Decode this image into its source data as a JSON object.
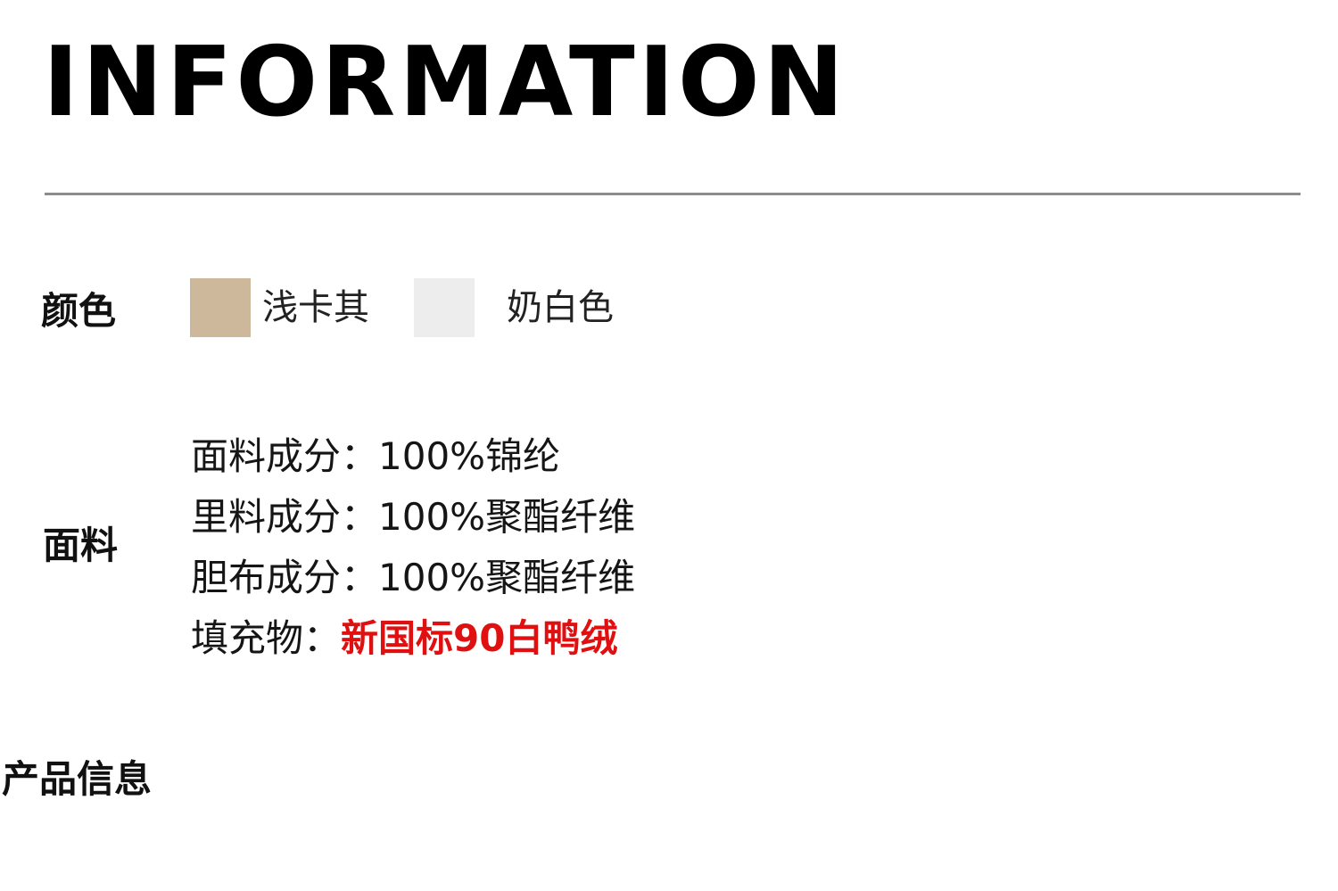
{
  "heading": "INFORMATION",
  "color_section": {
    "label": "颜色",
    "swatches": [
      {
        "name": "浅卡其",
        "hex": "#cdb89c"
      },
      {
        "name": "奶白色",
        "hex": "#ededed"
      }
    ]
  },
  "fabric_section": {
    "label": "面料",
    "lines": [
      {
        "label": "面料成分：",
        "value": "100%锦纶"
      },
      {
        "label": "里料成分：",
        "value": "100%聚酯纤维"
      },
      {
        "label": "胆布成分：",
        "value": "100%聚酯纤维"
      },
      {
        "label": "填充物：",
        "value": "新国标90白鸭绒",
        "highlight_color": "#e01010"
      }
    ]
  },
  "product_section": {
    "label": "产品信息"
  }
}
